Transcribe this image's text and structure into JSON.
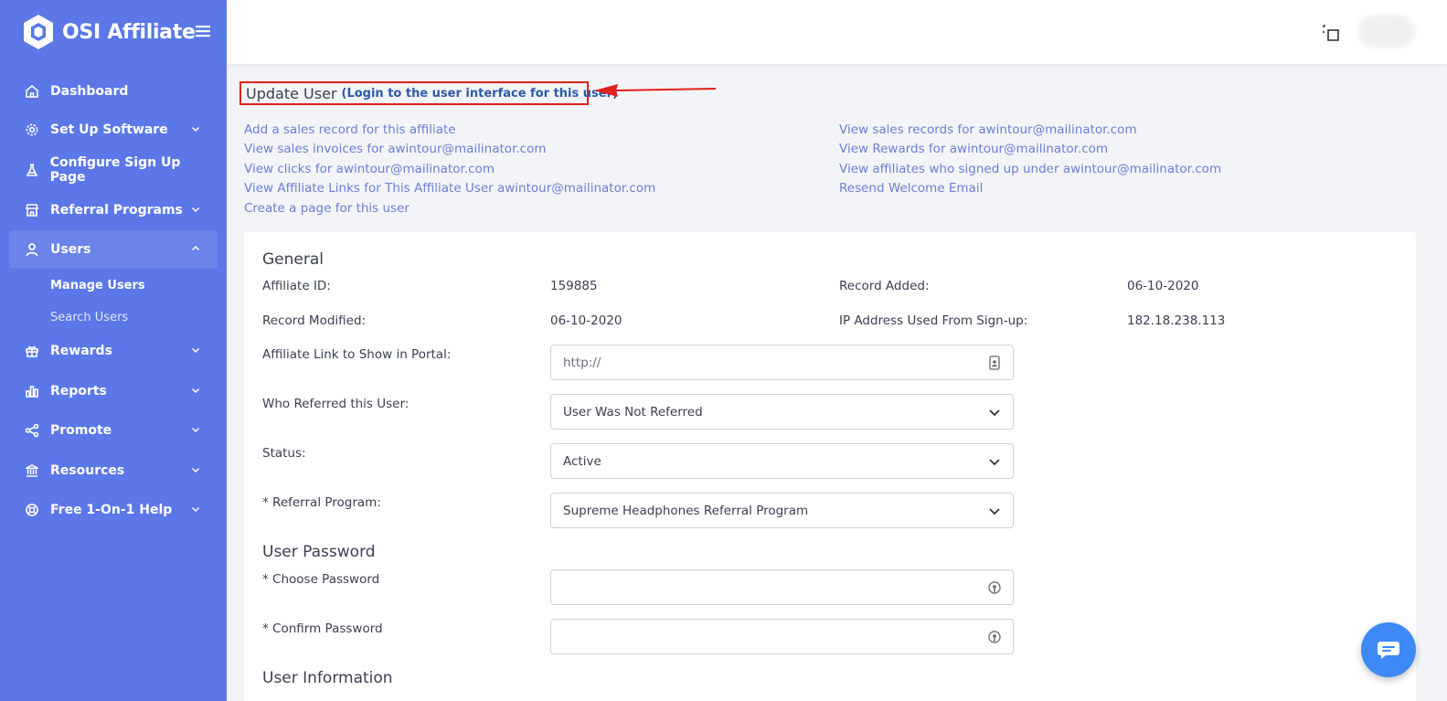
{
  "brand": {
    "name": "OSI Affiliate"
  },
  "nav": {
    "dashboard": "Dashboard",
    "setup": "Set Up Software",
    "signup": "Configure Sign Up Page",
    "referral": "Referral Programs",
    "users": "Users",
    "manage_users": "Manage Users",
    "search_users": "Search Users",
    "rewards": "Rewards",
    "reports": "Reports",
    "promote": "Promote",
    "resources": "Resources",
    "help": "Free 1-On-1 Help"
  },
  "page": {
    "title": "Update User",
    "login_link": "(Login to the user interface for this user)"
  },
  "links": {
    "add_sales": "Add a sales record for this affiliate",
    "view_invoices": "View sales invoices for awintour@mailinator.com",
    "view_clicks": "View clicks for awintour@mailinator.com",
    "view_affiliate_links": "View Affiliate Links for This Affiliate User awintour@mailinator.com",
    "create_page": "Create a page for this user",
    "view_sales": "View sales records for awintour@mailinator.com",
    "view_rewards": "View Rewards for awintour@mailinator.com",
    "view_signed_up": "View affiliates who signed up under awintour@mailinator.com",
    "resend_email": "Resend Welcome Email"
  },
  "general": {
    "heading": "General",
    "affiliate_id_label": "Affiliate ID:",
    "affiliate_id": "159885",
    "record_added_label": "Record Added:",
    "record_added": "06-10-2020",
    "record_modified_label": "Record Modified:",
    "record_modified": "06-10-2020",
    "ip_label": "IP Address Used From Sign-up:",
    "ip": "182.18.238.113",
    "portal_link_label": "Affiliate Link to Show in Portal:",
    "portal_link_placeholder": "http://",
    "referred_label": "Who Referred this User:",
    "referred_value": "User Was Not Referred",
    "status_label": "Status:",
    "status_value": "Active",
    "program_label": "* Referral Program:",
    "program_value": "Supreme Headphones Referral Program"
  },
  "password": {
    "heading": "User Password",
    "choose_label": "* Choose Password",
    "confirm_label": "* Confirm Password"
  },
  "info": {
    "heading": "User Information"
  },
  "colors": {
    "sidebar": "#5b77e8",
    "link": "#6b7fd6",
    "highlight": "#e0201a",
    "chat": "#3d8af7"
  }
}
